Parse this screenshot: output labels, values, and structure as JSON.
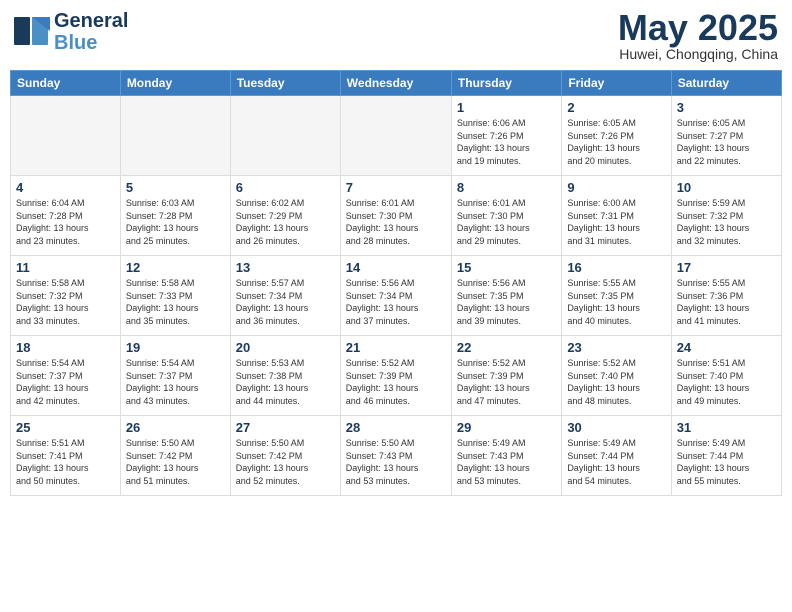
{
  "header": {
    "logo_general": "General",
    "logo_blue": "Blue",
    "month_year": "May 2025",
    "location": "Huwei, Chongqing, China"
  },
  "days_of_week": [
    "Sunday",
    "Monday",
    "Tuesday",
    "Wednesday",
    "Thursday",
    "Friday",
    "Saturday"
  ],
  "weeks": [
    [
      {
        "day": "",
        "info": ""
      },
      {
        "day": "",
        "info": ""
      },
      {
        "day": "",
        "info": ""
      },
      {
        "day": "",
        "info": ""
      },
      {
        "day": "1",
        "info": "Sunrise: 6:06 AM\nSunset: 7:26 PM\nDaylight: 13 hours\nand 19 minutes."
      },
      {
        "day": "2",
        "info": "Sunrise: 6:05 AM\nSunset: 7:26 PM\nDaylight: 13 hours\nand 20 minutes."
      },
      {
        "day": "3",
        "info": "Sunrise: 6:05 AM\nSunset: 7:27 PM\nDaylight: 13 hours\nand 22 minutes."
      }
    ],
    [
      {
        "day": "4",
        "info": "Sunrise: 6:04 AM\nSunset: 7:28 PM\nDaylight: 13 hours\nand 23 minutes."
      },
      {
        "day": "5",
        "info": "Sunrise: 6:03 AM\nSunset: 7:28 PM\nDaylight: 13 hours\nand 25 minutes."
      },
      {
        "day": "6",
        "info": "Sunrise: 6:02 AM\nSunset: 7:29 PM\nDaylight: 13 hours\nand 26 minutes."
      },
      {
        "day": "7",
        "info": "Sunrise: 6:01 AM\nSunset: 7:30 PM\nDaylight: 13 hours\nand 28 minutes."
      },
      {
        "day": "8",
        "info": "Sunrise: 6:01 AM\nSunset: 7:30 PM\nDaylight: 13 hours\nand 29 minutes."
      },
      {
        "day": "9",
        "info": "Sunrise: 6:00 AM\nSunset: 7:31 PM\nDaylight: 13 hours\nand 31 minutes."
      },
      {
        "day": "10",
        "info": "Sunrise: 5:59 AM\nSunset: 7:32 PM\nDaylight: 13 hours\nand 32 minutes."
      }
    ],
    [
      {
        "day": "11",
        "info": "Sunrise: 5:58 AM\nSunset: 7:32 PM\nDaylight: 13 hours\nand 33 minutes."
      },
      {
        "day": "12",
        "info": "Sunrise: 5:58 AM\nSunset: 7:33 PM\nDaylight: 13 hours\nand 35 minutes."
      },
      {
        "day": "13",
        "info": "Sunrise: 5:57 AM\nSunset: 7:34 PM\nDaylight: 13 hours\nand 36 minutes."
      },
      {
        "day": "14",
        "info": "Sunrise: 5:56 AM\nSunset: 7:34 PM\nDaylight: 13 hours\nand 37 minutes."
      },
      {
        "day": "15",
        "info": "Sunrise: 5:56 AM\nSunset: 7:35 PM\nDaylight: 13 hours\nand 39 minutes."
      },
      {
        "day": "16",
        "info": "Sunrise: 5:55 AM\nSunset: 7:35 PM\nDaylight: 13 hours\nand 40 minutes."
      },
      {
        "day": "17",
        "info": "Sunrise: 5:55 AM\nSunset: 7:36 PM\nDaylight: 13 hours\nand 41 minutes."
      }
    ],
    [
      {
        "day": "18",
        "info": "Sunrise: 5:54 AM\nSunset: 7:37 PM\nDaylight: 13 hours\nand 42 minutes."
      },
      {
        "day": "19",
        "info": "Sunrise: 5:54 AM\nSunset: 7:37 PM\nDaylight: 13 hours\nand 43 minutes."
      },
      {
        "day": "20",
        "info": "Sunrise: 5:53 AM\nSunset: 7:38 PM\nDaylight: 13 hours\nand 44 minutes."
      },
      {
        "day": "21",
        "info": "Sunrise: 5:52 AM\nSunset: 7:39 PM\nDaylight: 13 hours\nand 46 minutes."
      },
      {
        "day": "22",
        "info": "Sunrise: 5:52 AM\nSunset: 7:39 PM\nDaylight: 13 hours\nand 47 minutes."
      },
      {
        "day": "23",
        "info": "Sunrise: 5:52 AM\nSunset: 7:40 PM\nDaylight: 13 hours\nand 48 minutes."
      },
      {
        "day": "24",
        "info": "Sunrise: 5:51 AM\nSunset: 7:40 PM\nDaylight: 13 hours\nand 49 minutes."
      }
    ],
    [
      {
        "day": "25",
        "info": "Sunrise: 5:51 AM\nSunset: 7:41 PM\nDaylight: 13 hours\nand 50 minutes."
      },
      {
        "day": "26",
        "info": "Sunrise: 5:50 AM\nSunset: 7:42 PM\nDaylight: 13 hours\nand 51 minutes."
      },
      {
        "day": "27",
        "info": "Sunrise: 5:50 AM\nSunset: 7:42 PM\nDaylight: 13 hours\nand 52 minutes."
      },
      {
        "day": "28",
        "info": "Sunrise: 5:50 AM\nSunset: 7:43 PM\nDaylight: 13 hours\nand 53 minutes."
      },
      {
        "day": "29",
        "info": "Sunrise: 5:49 AM\nSunset: 7:43 PM\nDaylight: 13 hours\nand 53 minutes."
      },
      {
        "day": "30",
        "info": "Sunrise: 5:49 AM\nSunset: 7:44 PM\nDaylight: 13 hours\nand 54 minutes."
      },
      {
        "day": "31",
        "info": "Sunrise: 5:49 AM\nSunset: 7:44 PM\nDaylight: 13 hours\nand 55 minutes."
      }
    ]
  ]
}
